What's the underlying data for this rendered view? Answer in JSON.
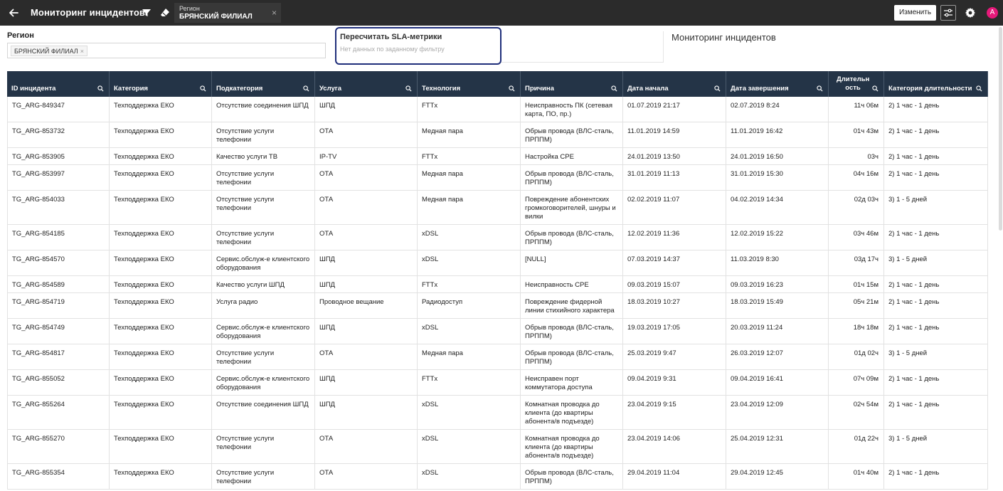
{
  "header": {
    "title": "Мониторинг инцидентов",
    "region_chip_label": "Регион",
    "region_chip_value": "БРЯНСКИЙ ФИЛИАЛ",
    "region_chip_close": "×",
    "edit_button": "Изменить",
    "avatar_letter": "A"
  },
  "filters": {
    "region_label": "Регион",
    "region_tag": "БРЯНСКИЙ ФИЛИАЛ",
    "region_tag_remove": "×"
  },
  "sla_card": {
    "title": "Пересчитать SLA-метрики",
    "subtitle": "Нет данных по заданному фильтру"
  },
  "panel_title": "Мониторинг инцидентов",
  "colors": {
    "topbar": "#2b2b2b",
    "table_header": "#243447",
    "card_border": "#1f2e7a",
    "avatar": "#e6197a"
  },
  "table": {
    "columns": [
      {
        "key": "id",
        "label": "ID инцидента"
      },
      {
        "key": "category",
        "label": "Категория"
      },
      {
        "key": "subcategory",
        "label": "Подкатегория"
      },
      {
        "key": "service",
        "label": "Услуга"
      },
      {
        "key": "technology",
        "label": "Технология"
      },
      {
        "key": "cause",
        "label": "Причина"
      },
      {
        "key": "start",
        "label": "Дата начала"
      },
      {
        "key": "end",
        "label": "Дата завершения"
      },
      {
        "key": "duration",
        "label": "Длительн ость"
      },
      {
        "key": "duration_category",
        "label": "Категория длительности"
      }
    ],
    "rows": [
      {
        "id": "TG_ARG-849347",
        "category": "Техподдержка ЕКО",
        "subcategory": "Отсутствие соединения ШПД",
        "service": "ШПД",
        "technology": "FTTx",
        "cause": "Неисправность ПК (сетевая карта, ПО, пр.)",
        "start": "01.07.2019 21:17",
        "end": "02.07.2019 8:24",
        "duration": "11ч 06м",
        "duration_category": "2) 1 час - 1 день"
      },
      {
        "id": "TG_ARG-853732",
        "category": "Техподдержка ЕКО",
        "subcategory": "Отсутствие услуги телефонии",
        "service": "ОТА",
        "technology": "Медная пара",
        "cause": "Обрыв провода (ВЛС-сталь, ПРППМ)",
        "start": "11.01.2019 14:59",
        "end": "11.01.2019 16:42",
        "duration": "01ч 43м",
        "duration_category": "2) 1 час - 1 день"
      },
      {
        "id": "TG_ARG-853905",
        "category": "Техподдержка ЕКО",
        "subcategory": "Качество услуги ТВ",
        "service": "IP-TV",
        "technology": "FTTx",
        "cause": "Настройка CPE",
        "start": "24.01.2019 13:50",
        "end": "24.01.2019 16:50",
        "duration": "03ч",
        "duration_category": "2) 1 час - 1 день"
      },
      {
        "id": "TG_ARG-853997",
        "category": "Техподдержка ЕКО",
        "subcategory": "Отсутствие услуги телефонии",
        "service": "ОТА",
        "technology": "Медная пара",
        "cause": "Обрыв провода (ВЛС-сталь, ПРППМ)",
        "start": "31.01.2019 11:13",
        "end": "31.01.2019 15:30",
        "duration": "04ч 16м",
        "duration_category": "2) 1 час - 1 день"
      },
      {
        "id": "TG_ARG-854033",
        "category": "Техподдержка ЕКО",
        "subcategory": "Отсутствие услуги телефонии",
        "service": "ОТА",
        "technology": "Медная пара",
        "cause": "Повреждение абонентских громкоговорителей, шнуры и вилки",
        "start": "02.02.2019 11:07",
        "end": "04.02.2019 14:34",
        "duration": "02д 03ч",
        "duration_category": "3) 1 - 5 дней"
      },
      {
        "id": "TG_ARG-854185",
        "category": "Техподдержка ЕКО",
        "subcategory": "Отсутствие услуги телефонии",
        "service": "ОТА",
        "technology": "xDSL",
        "cause": "Обрыв провода (ВЛС-сталь, ПРППМ)",
        "start": "12.02.2019 11:36",
        "end": "12.02.2019 15:22",
        "duration": "03ч 46м",
        "duration_category": "2) 1 час - 1 день"
      },
      {
        "id": "TG_ARG-854570",
        "category": "Техподдержка ЕКО",
        "subcategory": "Сервис.обслуж-е клиентского оборудования",
        "service": "ШПД",
        "technology": "xDSL",
        "cause": "[NULL]",
        "start": "07.03.2019 14:37",
        "end": "11.03.2019 8:30",
        "duration": "03д 17ч",
        "duration_category": "3) 1 - 5 дней"
      },
      {
        "id": "TG_ARG-854589",
        "category": "Техподдержка ЕКО",
        "subcategory": "Качество услуги ШПД",
        "service": "ШПД",
        "technology": "FTTx",
        "cause": "Неисправность CPE",
        "start": "09.03.2019 15:07",
        "end": "09.03.2019 16:23",
        "duration": "01ч 15м",
        "duration_category": "2) 1 час - 1 день"
      },
      {
        "id": "TG_ARG-854719",
        "category": "Техподдержка ЕКО",
        "subcategory": "Услуга радио",
        "service": "Проводное вещание",
        "technology": "Радиодоступ",
        "cause": "Повреждение фидерной линии стихийного характера",
        "start": "18.03.2019 10:27",
        "end": "18.03.2019 15:49",
        "duration": "05ч 21м",
        "duration_category": "2) 1 час - 1 день"
      },
      {
        "id": "TG_ARG-854749",
        "category": "Техподдержка ЕКО",
        "subcategory": "Сервис.обслуж-е клиентского оборудования",
        "service": "ШПД",
        "technology": "xDSL",
        "cause": "Обрыв провода (ВЛС-сталь, ПРППМ)",
        "start": "19.03.2019 17:05",
        "end": "20.03.2019 11:24",
        "duration": "18ч 18м",
        "duration_category": "2) 1 час - 1 день"
      },
      {
        "id": "TG_ARG-854817",
        "category": "Техподдержка ЕКО",
        "subcategory": "Отсутствие услуги телефонии",
        "service": "ОТА",
        "technology": "Медная пара",
        "cause": "Обрыв провода (ВЛС-сталь, ПРППМ)",
        "start": "25.03.2019 9:47",
        "end": "26.03.2019 12:07",
        "duration": "01д 02ч",
        "duration_category": "3) 1 - 5 дней"
      },
      {
        "id": "TG_ARG-855052",
        "category": "Техподдержка ЕКО",
        "subcategory": "Сервис.обслуж-е клиентского оборудования",
        "service": "ШПД",
        "technology": "FTTx",
        "cause": "Неисправен порт коммутатора доступа",
        "start": "09.04.2019 9:31",
        "end": "09.04.2019 16:41",
        "duration": "07ч 09м",
        "duration_category": "2) 1 час - 1 день"
      },
      {
        "id": "TG_ARG-855264",
        "category": "Техподдержка ЕКО",
        "subcategory": "Отсутствие соединения ШПД",
        "service": "ШПД",
        "technology": "xDSL",
        "cause": "Комнатная проводка до клиента (до квартиры абонента/в подъезде)",
        "start": "23.04.2019 9:15",
        "end": "23.04.2019 12:09",
        "duration": "02ч 54м",
        "duration_category": "2) 1 час - 1 день"
      },
      {
        "id": "TG_ARG-855270",
        "category": "Техподдержка ЕКО",
        "subcategory": "Отсутствие услуги телефонии",
        "service": "ОТА",
        "technology": "xDSL",
        "cause": "Комнатная проводка до клиента (до квартиры абонента/в подъезде)",
        "start": "23.04.2019 14:06",
        "end": "25.04.2019 12:31",
        "duration": "01д 22ч",
        "duration_category": "3) 1 - 5 дней"
      },
      {
        "id": "TG_ARG-855354",
        "category": "Техподдержка ЕКО",
        "subcategory": "Отсутствие услуги телефонии",
        "service": "ОТА",
        "technology": "xDSL",
        "cause": "Обрыв провода (ВЛС-сталь, ПРППМ)",
        "start": "29.04.2019 11:04",
        "end": "29.04.2019 12:45",
        "duration": "01ч 40м",
        "duration_category": "2) 1 час - 1 день"
      }
    ]
  }
}
